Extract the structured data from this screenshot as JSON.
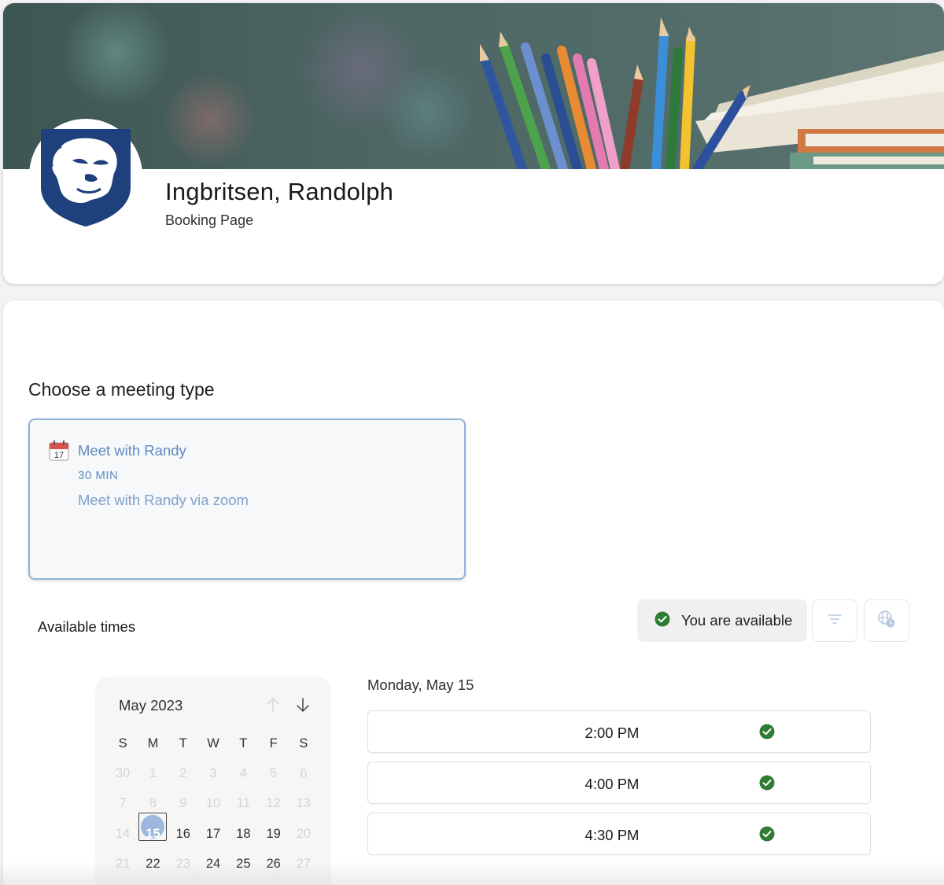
{
  "header": {
    "owner_name": "Ingbritsen, Randolph",
    "subtitle": "Booking Page"
  },
  "services": {
    "section_title": "Choose a meeting type",
    "items": [
      {
        "icon_day": "17",
        "name": "Meet with Randy",
        "duration": "30 MIN",
        "description": "Meet with Randy via zoom"
      }
    ]
  },
  "availability": {
    "label": "Available times",
    "status": "You are available",
    "status_color": "#2e7d32"
  },
  "calendar": {
    "month_label": "May 2023",
    "weekdays": [
      "S",
      "M",
      "T",
      "W",
      "T",
      "F",
      "S"
    ],
    "weeks": [
      [
        "30",
        "1",
        "2",
        "3",
        "4",
        "5",
        "6"
      ],
      [
        "7",
        "8",
        "9",
        "10",
        "11",
        "12",
        "13"
      ],
      [
        "14",
        "15",
        "16",
        "17",
        "18",
        "19",
        "20"
      ],
      [
        "21",
        "22",
        "23",
        "24",
        "25",
        "26",
        "27"
      ]
    ],
    "selected": "15"
  },
  "slots": {
    "date_heading": "Monday, May 15",
    "times": [
      "2:00 PM",
      "4:00 PM",
      "4:30 PM"
    ]
  },
  "colors": {
    "accent": "#5f8cc0",
    "selected_day": "#9db8dc",
    "available_check": "#2e7d32"
  }
}
